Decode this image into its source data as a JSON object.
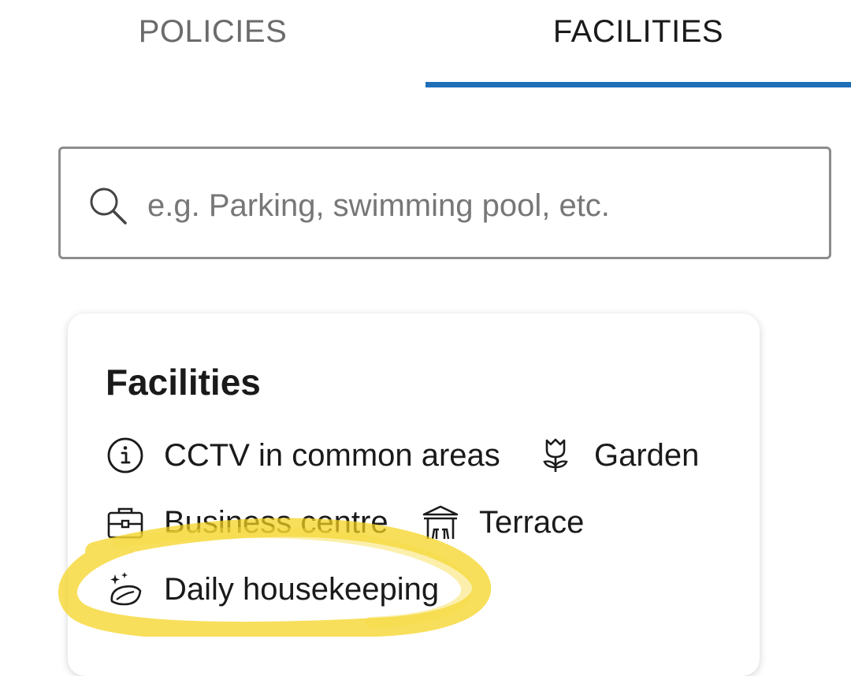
{
  "tabs": [
    {
      "label": "POLICIES",
      "active": false
    },
    {
      "label": "FACILITIES",
      "active": true
    }
  ],
  "accent_color": "#1f6fb8",
  "search": {
    "placeholder": "e.g. Parking, swimming pool, etc.",
    "value": "",
    "icon": "search-icon"
  },
  "card": {
    "title": "Facilities",
    "items": [
      {
        "label": "CCTV in common areas",
        "icon": "info-icon"
      },
      {
        "label": "Garden",
        "icon": "flower-icon"
      },
      {
        "label": "Business centre",
        "icon": "briefcase-icon"
      },
      {
        "label": "Terrace",
        "icon": "pavilion-icon"
      },
      {
        "label": "Daily housekeeping",
        "icon": "housekeeping-sparkle-icon"
      }
    ]
  },
  "annotation": {
    "type": "hand-drawn highlight circle",
    "color": "#f5d21c"
  }
}
